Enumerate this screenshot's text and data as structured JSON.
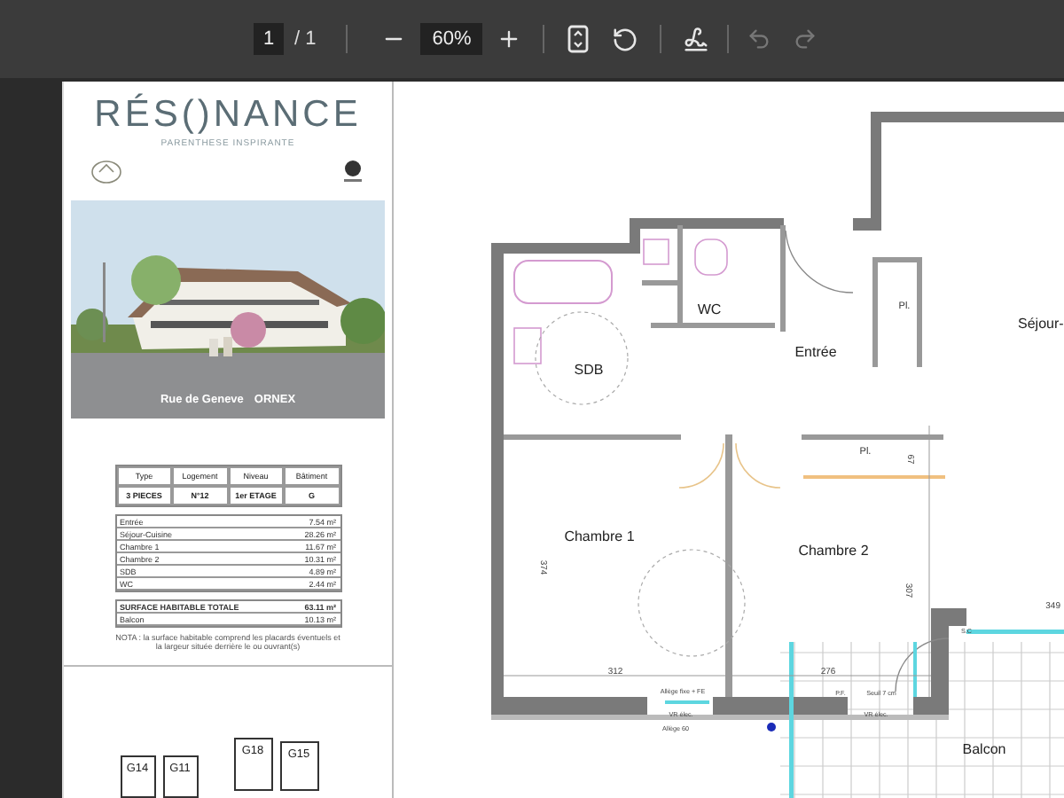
{
  "toolbar": {
    "page": "1",
    "page_total": "/ 1",
    "zoom": "60%",
    "undo_disabled": true,
    "redo_disabled": true
  },
  "brochure": {
    "title": "RÉS()NANCE",
    "subtitle": "PARENTHESE INSPIRANTE",
    "photo": {
      "kind": "picture",
      "caption_street": "Rue de Geneve",
      "caption_town": "ORNEX"
    },
    "summary": {
      "columns": [
        "Type",
        "Logement",
        "Niveau",
        "Bâtiment"
      ],
      "row": [
        "3 PIECES",
        "N°12",
        "1er ETAGE",
        "G"
      ]
    },
    "areas": [
      {
        "room": "Entrée",
        "area": "7.54 m²"
      },
      {
        "room": "Séjour-Cuisine",
        "area": "28.26 m²"
      },
      {
        "room": "Chambre 1",
        "area": "11.67 m²"
      },
      {
        "room": "Chambre 2",
        "area": "10.31 m²"
      },
      {
        "room": "SDB",
        "area": "4.89 m²"
      },
      {
        "room": "WC",
        "area": "2.44 m²"
      }
    ],
    "total": {
      "label": "SURFACE HABITABLE TOTALE",
      "area": "63.11 m²"
    },
    "balcony": {
      "label": "Balcon",
      "area": "10.13 m²"
    },
    "note": "NOTA : la surface habitable comprend les placards éventuels et la largeur située derrière le ou ouvrant(s)",
    "site_buildings": [
      "G14",
      "G11",
      "G18",
      "G15"
    ]
  },
  "plan": {
    "labels": [
      {
        "text": "Pl.",
        "kind": "small"
      },
      {
        "text": "WC",
        "kind": "room"
      },
      {
        "text": "Séjour-",
        "kind": "room"
      },
      {
        "text": "Entrée",
        "kind": "room"
      },
      {
        "text": "SDB",
        "kind": "room"
      },
      {
        "text": "Pl.",
        "kind": "small"
      },
      {
        "text": "67",
        "kind": "dimension"
      },
      {
        "text": "Chambre 1",
        "kind": "room"
      },
      {
        "text": "Chambre 2",
        "kind": "room"
      },
      {
        "text": "374",
        "kind": "dimension"
      },
      {
        "text": "307",
        "kind": "dimension"
      },
      {
        "text": "349",
        "kind": "dimension"
      },
      {
        "text": "S.C",
        "kind": "note"
      },
      {
        "text": "312",
        "kind": "dimension"
      },
      {
        "text": "276",
        "kind": "dimension"
      },
      {
        "text": "Allège fixe + FE",
        "kind": "note"
      },
      {
        "text": "P.F.",
        "kind": "note"
      },
      {
        "text": "Seuil 7 cm",
        "kind": "note"
      },
      {
        "text": "VR élec.",
        "kind": "note"
      },
      {
        "text": "VR élec.",
        "kind": "note"
      },
      {
        "text": "Allège 60",
        "kind": "note"
      },
      {
        "text": "Balcon",
        "kind": "room"
      }
    ]
  }
}
